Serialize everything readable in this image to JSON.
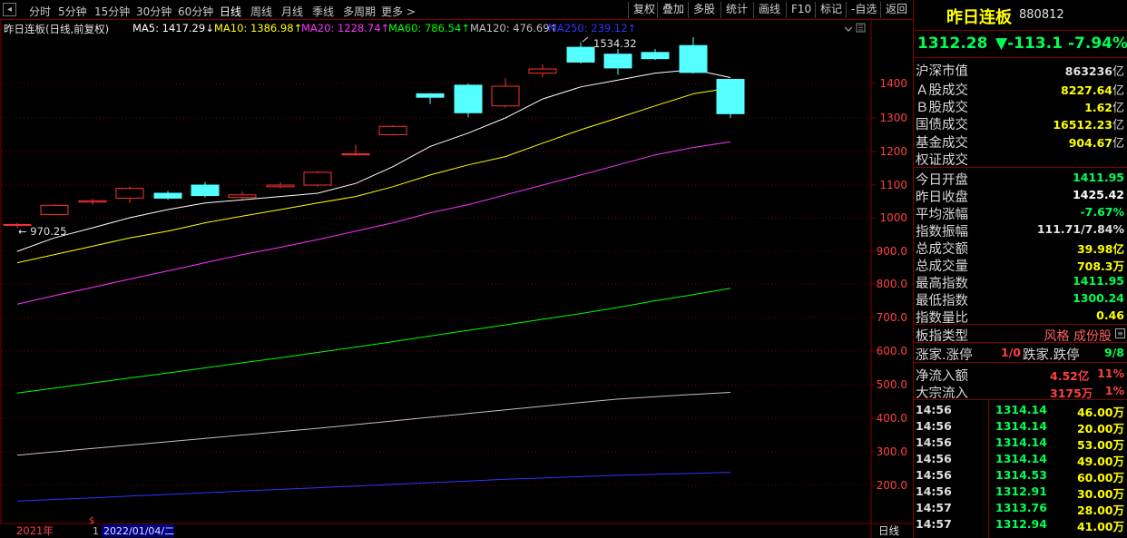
{
  "toolbar": {
    "timeframes": [
      "分时",
      "5分钟",
      "15分钟",
      "30分钟",
      "60分钟",
      "日线",
      "周线",
      "月线",
      "季线",
      "多周期",
      "更多 >"
    ],
    "active_timeframe": "日线",
    "buttons": [
      "复权",
      "叠加",
      "多股",
      "统计",
      "画线",
      "F10",
      "标记",
      "-自选",
      "返回"
    ]
  },
  "chart": {
    "title": "昨日连板(日线,前复权)",
    "ma": [
      {
        "label": "MA5: 1417.29↓",
        "color": "#ffffff"
      },
      {
        "label": "MA10: 1386.98↑",
        "color": "#ffff00"
      },
      {
        "label": "MA20: 1228.74↑",
        "color": "#ff33ff"
      },
      {
        "label": "MA60: 786.54↑",
        "color": "#00ff00"
      },
      {
        "label": "MA120: 476.69↑",
        "color": "#c0c0c0"
      },
      {
        "label": "MA250: 239.12↑",
        "color": "#3333ff"
      }
    ],
    "high_label": "1534.32",
    "low_label": "970.25",
    "y_axis_labels": [
      "1400",
      "1300",
      "1200",
      "1100",
      "1000",
      "900.0",
      "800.0",
      "700.0",
      "600.0",
      "500.0",
      "400.0",
      "300.0",
      "200.0"
    ],
    "bottom": {
      "year_label": "2021年",
      "marker": "1",
      "date_label": "2022/01/04/二",
      "period_label": "日线",
      "dollar_icon": "$"
    },
    "colors": {
      "up": "#ff3232",
      "down": "#54ffff",
      "grid": "#800000",
      "axis_text": "#ff4040"
    }
  },
  "panel": {
    "name": "昨日连板",
    "code": "880812",
    "price": "1312.28",
    "change": "▼-113.1",
    "change_pct": "-7.94%",
    "market_rows": [
      {
        "label": "沪深市值",
        "value": "863236",
        "unit": "亿",
        "color": "#e0e0e0"
      },
      {
        "label": "Ａ股成交",
        "value": "8227.64",
        "unit": "亿",
        "color": "#ffff00"
      },
      {
        "label": "Ｂ股成交",
        "value": "1.62",
        "unit": "亿",
        "color": "#ffff00"
      },
      {
        "label": "国债成交",
        "value": "16512.23",
        "unit": "亿",
        "color": "#ffff00"
      },
      {
        "label": "基金成交",
        "value": "904.67",
        "unit": "亿",
        "color": "#ffff00"
      },
      {
        "label": "权证成交",
        "value": "",
        "unit": "",
        "color": "#ffff00"
      }
    ],
    "index_rows": [
      {
        "label": "今日开盘",
        "value": "1411.95",
        "color": "#00ff55"
      },
      {
        "label": "昨日收盘",
        "value": "1425.42",
        "color": "#ffffff"
      },
      {
        "label": "平均涨幅",
        "value": "-7.67%",
        "color": "#00ff55"
      },
      {
        "label": "指数振幅",
        "value": "111.71/7.84%",
        "color": "#e0e0e0"
      },
      {
        "label": "总成交额",
        "value": "39.98亿",
        "color": "#ffff00"
      },
      {
        "label": "总成交量",
        "value": "708.3万",
        "color": "#ffff00"
      },
      {
        "label": "最高指数",
        "value": "1411.95",
        "color": "#00ff55"
      },
      {
        "label": "最低指数",
        "value": "1300.24",
        "color": "#00ff55"
      },
      {
        "label": "指数量比",
        "value": "0.46",
        "color": "#ffff00"
      }
    ],
    "type_row": {
      "label": "板指类型",
      "value": "风格 成份股",
      "icon": "list-icon"
    },
    "limit_row": {
      "up_label": "涨家.涨停",
      "up_value": "1/0",
      "down_label": "跌家.跌停",
      "down_value": "9/8"
    },
    "flow_rows": [
      {
        "label": "净流入额",
        "value": "4.52亿",
        "pct": "11%"
      },
      {
        "label": "大宗流入",
        "value": "3175万",
        "pct": "1%"
      }
    ],
    "ticks": [
      {
        "time": "14:56",
        "price": "1314.14",
        "vol": "46.00万"
      },
      {
        "time": "14:56",
        "price": "1314.14",
        "vol": "20.00万"
      },
      {
        "time": "14:56",
        "price": "1314.14",
        "vol": "53.00万"
      },
      {
        "time": "14:56",
        "price": "1314.14",
        "vol": "49.00万"
      },
      {
        "time": "14:56",
        "price": "1314.53",
        "vol": "60.00万"
      },
      {
        "time": "14:56",
        "price": "1312.91",
        "vol": "30.00万"
      },
      {
        "time": "14:57",
        "price": "1313.76",
        "vol": "28.00万"
      },
      {
        "time": "14:57",
        "price": "1312.94",
        "vol": "41.00万"
      }
    ]
  },
  "chart_data": {
    "type": "candlestick",
    "title": "昨日连板(日线,前复权)",
    "ylim": [
      150,
      1560
    ],
    "candles": [
      {
        "o": 978,
        "c": 980,
        "h": 985,
        "l": 970
      },
      {
        "o": 1010,
        "c": 1038,
        "h": 1042,
        "l": 1008
      },
      {
        "o": 1048,
        "c": 1052,
        "h": 1058,
        "l": 1040
      },
      {
        "o": 1060,
        "c": 1090,
        "h": 1095,
        "l": 1045
      },
      {
        "o": 1075,
        "c": 1060,
        "h": 1082,
        "l": 1055
      },
      {
        "o": 1100,
        "c": 1068,
        "h": 1110,
        "l": 1062
      },
      {
        "o": 1062,
        "c": 1070,
        "h": 1080,
        "l": 1058
      },
      {
        "o": 1095,
        "c": 1100,
        "h": 1108,
        "l": 1090
      },
      {
        "o": 1100,
        "c": 1138,
        "h": 1142,
        "l": 1095
      },
      {
        "o": 1190,
        "c": 1193,
        "h": 1220,
        "l": 1188
      },
      {
        "o": 1250,
        "c": 1275,
        "h": 1278,
        "l": 1248
      },
      {
        "o": 1370,
        "c": 1360,
        "h": 1372,
        "l": 1340
      },
      {
        "o": 1395,
        "c": 1315,
        "h": 1400,
        "l": 1302
      },
      {
        "o": 1335,
        "c": 1392,
        "h": 1415,
        "l": 1330
      },
      {
        "o": 1430,
        "c": 1442,
        "h": 1456,
        "l": 1418
      },
      {
        "o": 1505,
        "c": 1462,
        "h": 1520,
        "l": 1458
      },
      {
        "o": 1485,
        "c": 1445,
        "h": 1500,
        "l": 1425
      },
      {
        "o": 1490,
        "c": 1472,
        "h": 1500,
        "l": 1468
      },
      {
        "o": 1510,
        "c": 1432,
        "h": 1534.32,
        "l": 1428
      },
      {
        "o": 1411.95,
        "c": 1312.28,
        "h": 1411.95,
        "l": 1300.24
      }
    ],
    "ma_series": [
      {
        "name": "MA5",
        "color": "#ffffff",
        "values": [
          900,
          940,
          970,
          1000,
          1025,
          1045,
          1055,
          1065,
          1075,
          1105,
          1155,
          1215,
          1255,
          1300,
          1355,
          1390,
          1410,
          1430,
          1440,
          1417
        ]
      },
      {
        "name": "MA10",
        "color": "#ffff00",
        "values": [
          865,
          890,
          915,
          940,
          960,
          985,
          1005,
          1025,
          1045,
          1065,
          1095,
          1130,
          1160,
          1185,
          1225,
          1265,
          1300,
          1335,
          1370,
          1387
        ]
      },
      {
        "name": "MA20",
        "color": "#ff33ff",
        "values": [
          740,
          765,
          790,
          815,
          840,
          865,
          890,
          912,
          935,
          960,
          985,
          1015,
          1040,
          1070,
          1100,
          1130,
          1160,
          1190,
          1212,
          1229
        ]
      },
      {
        "name": "MA60",
        "color": "#00ff00",
        "values": [
          475,
          490,
          505,
          520,
          535,
          550,
          565,
          580,
          596,
          612,
          628,
          645,
          662,
          678,
          695,
          712,
          730,
          750,
          768,
          787
        ]
      },
      {
        "name": "MA120",
        "color": "#c0c0c0",
        "values": [
          290,
          300,
          310,
          320,
          330,
          340,
          350,
          360,
          370,
          381,
          392,
          403,
          414,
          425,
          436,
          447,
          457,
          464,
          471,
          477
        ]
      },
      {
        "name": "MA250",
        "color": "#3333ff",
        "values": [
          153,
          158,
          163,
          168,
          173,
          178,
          183,
          188,
          193,
          198,
          203,
          208,
          213,
          218,
          222,
          226,
          230,
          233,
          236,
          239
        ]
      }
    ],
    "y_ticks": [
      1400,
      1300,
      1200,
      1100,
      1000,
      900,
      800,
      700,
      600,
      500,
      400,
      300,
      200
    ],
    "grid": true
  }
}
